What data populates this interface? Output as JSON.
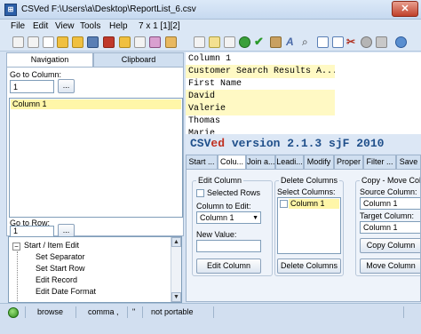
{
  "window": {
    "title": "CSVed F:\\Users\\a\\Desktop\\ReportList_6.csv",
    "app_icon": "csved-app-icon",
    "close_label": "✕"
  },
  "menu": {
    "items": [
      {
        "label": "File"
      },
      {
        "label": "Edit"
      },
      {
        "label": "View"
      },
      {
        "label": "Tools"
      },
      {
        "label": "Help"
      }
    ],
    "position_readout": "7 x 1 [1][2]"
  },
  "toolbar": {
    "icons": [
      "open-icon",
      "new-icon",
      "save-icon",
      "folder-icon",
      "table-icon",
      "edit-icon",
      "paste-icon",
      "copy-icon",
      "image-icon",
      "check-icon",
      "accept-icon",
      "undo-icon",
      "redo-icon",
      "font-icon",
      "zoom-icon",
      "view-icon",
      "grid-icon",
      "tools-icon",
      "delete-icon",
      "settings-icon",
      "help-icon"
    ]
  },
  "navigation": {
    "tabs": [
      {
        "label": "Navigation"
      },
      {
        "label": "Clipboard"
      }
    ],
    "go_to_column_label": "Go to Column:",
    "go_to_column_value": "1",
    "browse_button_label": "...",
    "columns": [
      "Column 1"
    ],
    "go_to_row_label": "Go to Row:",
    "go_to_row_value": "1",
    "tree": [
      {
        "label": "Start / Item Edit",
        "level": 0,
        "expanded": true
      },
      {
        "label": "Set Separator",
        "level": 1
      },
      {
        "label": "Set Start Row",
        "level": 1
      },
      {
        "label": "Edit Record",
        "level": 1
      },
      {
        "label": "Edit Date Format",
        "level": 1
      }
    ]
  },
  "grid": {
    "rows": [
      {
        "value": "Column 1",
        "highlighted": false
      },
      {
        "value": "Customer Search Results A...",
        "highlighted": true
      },
      {
        "value": "First Name",
        "highlighted": false
      },
      {
        "value": "David",
        "highlighted": true
      },
      {
        "value": "Valerie",
        "highlighted": false
      },
      {
        "value": "Thomas",
        "highlighted": true
      },
      {
        "value": "Marie",
        "highlighted": false
      }
    ]
  },
  "banner": {
    "prefix": "CSV",
    "highlight": "ed",
    "suffix": " version 2.1.3 sjF 2010"
  },
  "operation_tabs": [
    {
      "label": "Start ..."
    },
    {
      "label": "Colu..."
    },
    {
      "label": "Join a..."
    },
    {
      "label": "Leadi..."
    },
    {
      "label": "Modify"
    },
    {
      "label": "Proper"
    },
    {
      "label": "Filter ..."
    },
    {
      "label": "Save"
    }
  ],
  "edit_column": {
    "title": "Edit Column",
    "selected_rows_label": "Selected Rows",
    "column_to_edit_label": "Column to Edit:",
    "column_to_edit_value": "Column 1",
    "new_value_label": "New Value:",
    "new_value": "",
    "button_label": "Edit Column"
  },
  "delete_columns": {
    "title": "Delete Columns",
    "select_label": "Select Columns:",
    "items": [
      "Column 1"
    ],
    "button_label": "Delete Columns"
  },
  "copy_move": {
    "title": "Copy - Move Colu",
    "source_label": "Source Column:",
    "source_value": "Column 1",
    "target_label": "Target Column:",
    "target_value": "Column 1",
    "copy_button_label": "Copy Column",
    "move_button_label": "Move Column"
  },
  "status": {
    "mode": "browse",
    "separator": "comma ,",
    "quote": "\"",
    "portable": "not portable"
  },
  "colors": {
    "highlight_row": "#fff9c4",
    "selection": "#fff6a8",
    "banner_text": "#1f4f8a",
    "banner_accent": "#c03020"
  }
}
